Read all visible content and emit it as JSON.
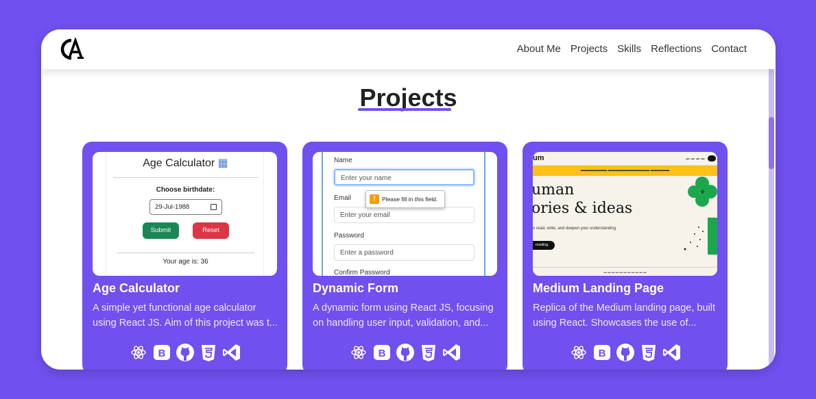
{
  "nav": {
    "links": [
      "About Me",
      "Projects",
      "Skills",
      "Reflections",
      "Contact"
    ]
  },
  "page": {
    "title": "Projects"
  },
  "projects": [
    {
      "title": "Age Calculator",
      "desc_line1": "A simple yet functional age calculator",
      "desc_line2": "using React JS. Aim of this project was t...",
      "preview": {
        "heading": "Age Calculator",
        "label": "Choose birthdate:",
        "date_value": "29-Jul-1988",
        "submit": "Submit",
        "reset": "Reset",
        "result": "Your age is: 36"
      }
    },
    {
      "title": "Dynamic Form",
      "desc_line1": "A dynamic form using React JS, focusing",
      "desc_line2": "on handling user input, validation, and...",
      "preview": {
        "name_label": "Name",
        "name_placeholder": "Enter your name",
        "email_label": "Email",
        "email_placeholder": "Enter your email",
        "password_label": "Password",
        "password_placeholder": "Enter a password",
        "confirm_label": "Confirm Password",
        "tooltip": "Please fill in this field."
      }
    },
    {
      "title": "Medium Landing Page",
      "desc_line1": "Replica of the Medium landing page, built",
      "desc_line2": "using React. Showcases the use of...",
      "preview": {
        "logo": "um",
        "headline_line1": "uman",
        "headline_line2": "ories & ideas",
        "subtext": "o read, write, and deepen your understanding",
        "button": "reading"
      }
    }
  ],
  "tech_icons": [
    "react-icon",
    "bootstrap-icon",
    "github-icon",
    "css3-icon",
    "vscode-icon"
  ],
  "colors": {
    "accent": "#7050ee",
    "card": "#7050ee",
    "submit": "#198754",
    "reset": "#dc3545"
  }
}
